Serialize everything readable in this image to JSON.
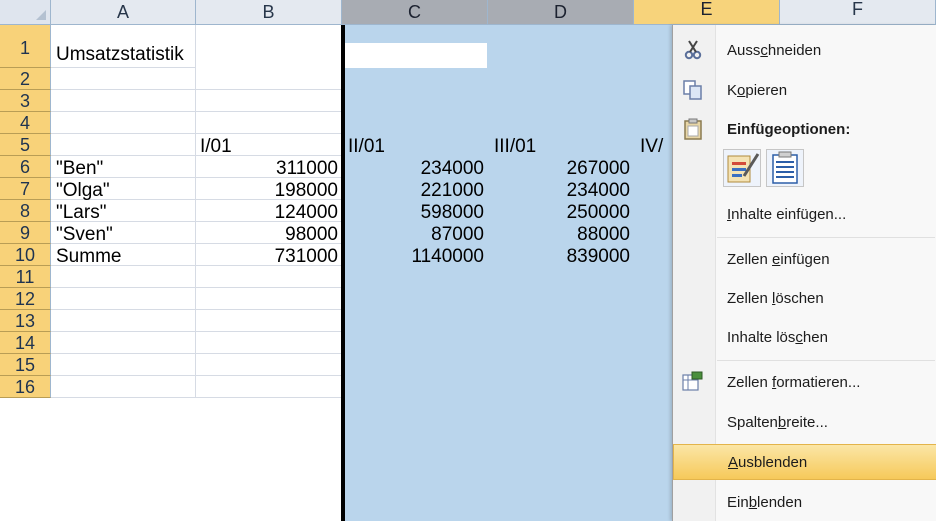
{
  "columns": [
    "A",
    "B",
    "C",
    "D",
    "E",
    "F"
  ],
  "rows": [
    "1",
    "2",
    "3",
    "4",
    "5",
    "6",
    "7",
    "8",
    "9",
    "10",
    "11",
    "12",
    "13",
    "14",
    "15",
    "16"
  ],
  "cells": {
    "title": "Umsatzstatistik",
    "headers": [
      "I/01",
      "II/01",
      "III/01",
      "IV/"
    ],
    "data": [
      {
        "name": "\"Ben\"",
        "b": "311000",
        "c": "234000",
        "d": "267000"
      },
      {
        "name": "\"Olga\"",
        "b": "198000",
        "c": "221000",
        "d": "234000"
      },
      {
        "name": "\"Lars\"",
        "b": "124000",
        "c": "598000",
        "d": "250000"
      },
      {
        "name": "\"Sven\"",
        "b": "98000",
        "c": "87000",
        "d": "88000"
      },
      {
        "name": "Summe",
        "b": "731000",
        "c": "1140000",
        "d": "839000"
      }
    ]
  },
  "menu": {
    "cut": {
      "before": "Auss",
      "u": "c",
      "after": "hneiden"
    },
    "copy": {
      "before": "K",
      "u": "o",
      "after": "pieren"
    },
    "paste_options": "Einfügeoptionen:",
    "paste_special": {
      "before": "",
      "u": "I",
      "after": "nhalte einfügen..."
    },
    "insert_cells": {
      "before": "Zellen ",
      "u": "e",
      "after": "infügen"
    },
    "delete_cells": {
      "before": "Zellen ",
      "u": "l",
      "after": "öschen"
    },
    "clear_contents": {
      "before": "Inhalte lös",
      "u": "c",
      "after": "hen"
    },
    "format_cells": {
      "before": "Zellen ",
      "u": "f",
      "after": "ormatieren..."
    },
    "column_width": {
      "before": "Spalten",
      "u": "b",
      "after": "reite..."
    },
    "hide": {
      "before": "",
      "u": "A",
      "after": "usblenden"
    },
    "unhide": {
      "before": "Ein",
      "u": "b",
      "after": "lenden"
    }
  },
  "colors": {
    "selection": "#bad5ec",
    "row_header": "#f8d279",
    "menu_hover": "#f6c95a"
  }
}
